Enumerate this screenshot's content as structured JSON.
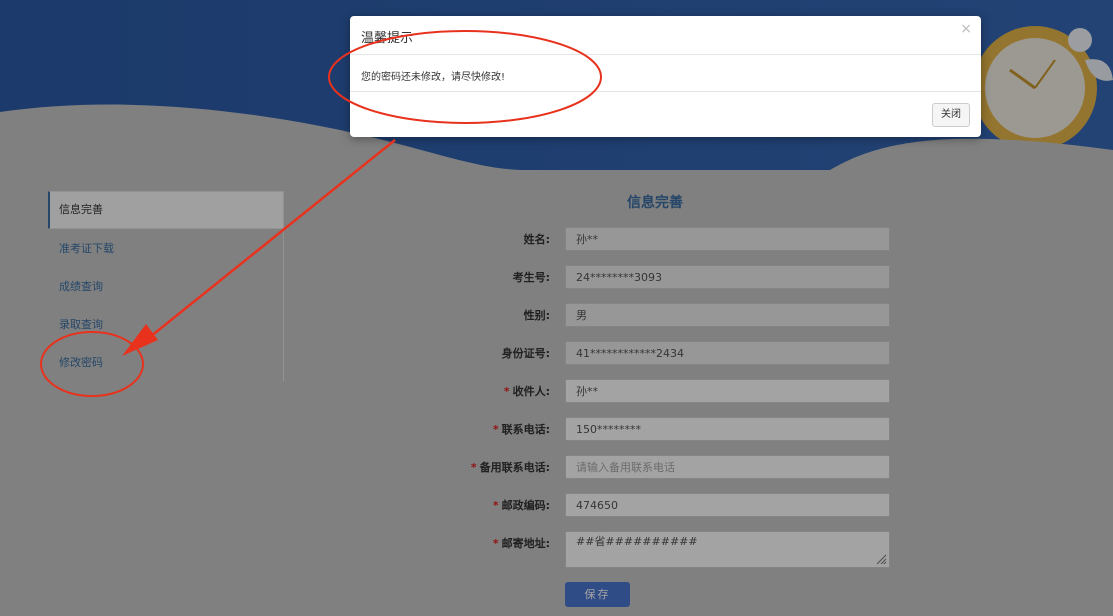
{
  "sidebar": {
    "items": [
      {
        "label": "信息完善",
        "active": true
      },
      {
        "label": "准考证下载",
        "active": false
      },
      {
        "label": "成绩查询",
        "active": false
      },
      {
        "label": "录取查询",
        "active": false
      },
      {
        "label": "修改密码",
        "active": false
      }
    ]
  },
  "form": {
    "title": "信息完善",
    "fields": [
      {
        "label": "姓名:",
        "value": "孙**",
        "required": false,
        "readonly": true
      },
      {
        "label": "考生号:",
        "value": "24********3093",
        "required": false,
        "readonly": true
      },
      {
        "label": "性别:",
        "value": "男",
        "required": false,
        "readonly": true
      },
      {
        "label": "身份证号:",
        "value": "41************2434",
        "required": false,
        "readonly": true
      },
      {
        "label": "收件人:",
        "value": "孙**",
        "required": true,
        "readonly": false
      },
      {
        "label": "联系电话:",
        "value": "150********",
        "required": true,
        "readonly": false
      },
      {
        "label": "备用联系电话:",
        "value": "",
        "placeholder": "请输入备用联系电话",
        "required": true,
        "readonly": false
      },
      {
        "label": "邮政编码:",
        "value": "474650",
        "required": true,
        "readonly": false
      },
      {
        "label": "邮寄地址:",
        "value": "##省##########",
        "required": true,
        "readonly": false
      }
    ],
    "required_mark": "*",
    "save_label": "保存"
  },
  "modal": {
    "title": "温馨提示",
    "close_glyph": "×",
    "message": "您的密码还未修改，请尽快修改!",
    "button_label": "关闭"
  },
  "colors": {
    "accent": "#3a6ea5",
    "banner": "#2f5fae",
    "save_button": "#4a77d4",
    "annotation": "#e8321e"
  }
}
